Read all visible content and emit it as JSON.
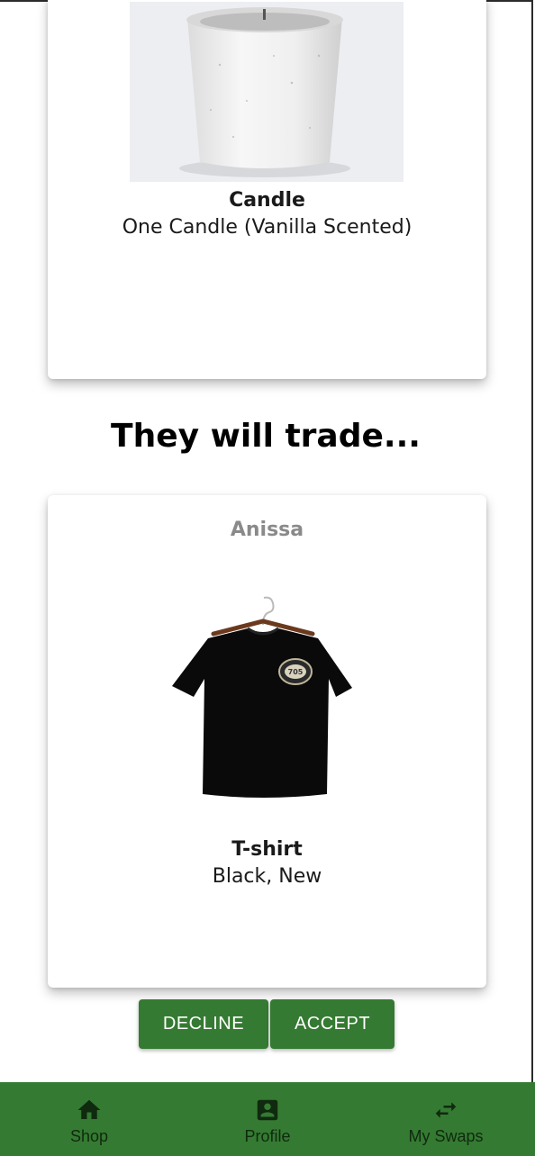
{
  "offer_item": {
    "title": "Candle",
    "description": "One Candle (Vanilla Scented)",
    "image_icon": "candle-photo"
  },
  "section_heading": "They will trade...",
  "their_item": {
    "owner": "Anissa",
    "title": "T-shirt",
    "description": "Black, New",
    "image_icon": "tshirt-photo",
    "shirt_badge": "705"
  },
  "actions": {
    "decline_label": "DECLINE",
    "accept_label": "ACCEPT"
  },
  "bottom_nav": {
    "items": [
      {
        "label": "Shop",
        "icon": "home-icon"
      },
      {
        "label": "Profile",
        "icon": "account-box-icon"
      },
      {
        "label": "My Swaps",
        "icon": "swap-horiz-icon"
      }
    ]
  },
  "colors": {
    "primary_green": "#357a32",
    "nav_label": "#0f2a0e",
    "owner_gray": "#8a8a8a"
  }
}
